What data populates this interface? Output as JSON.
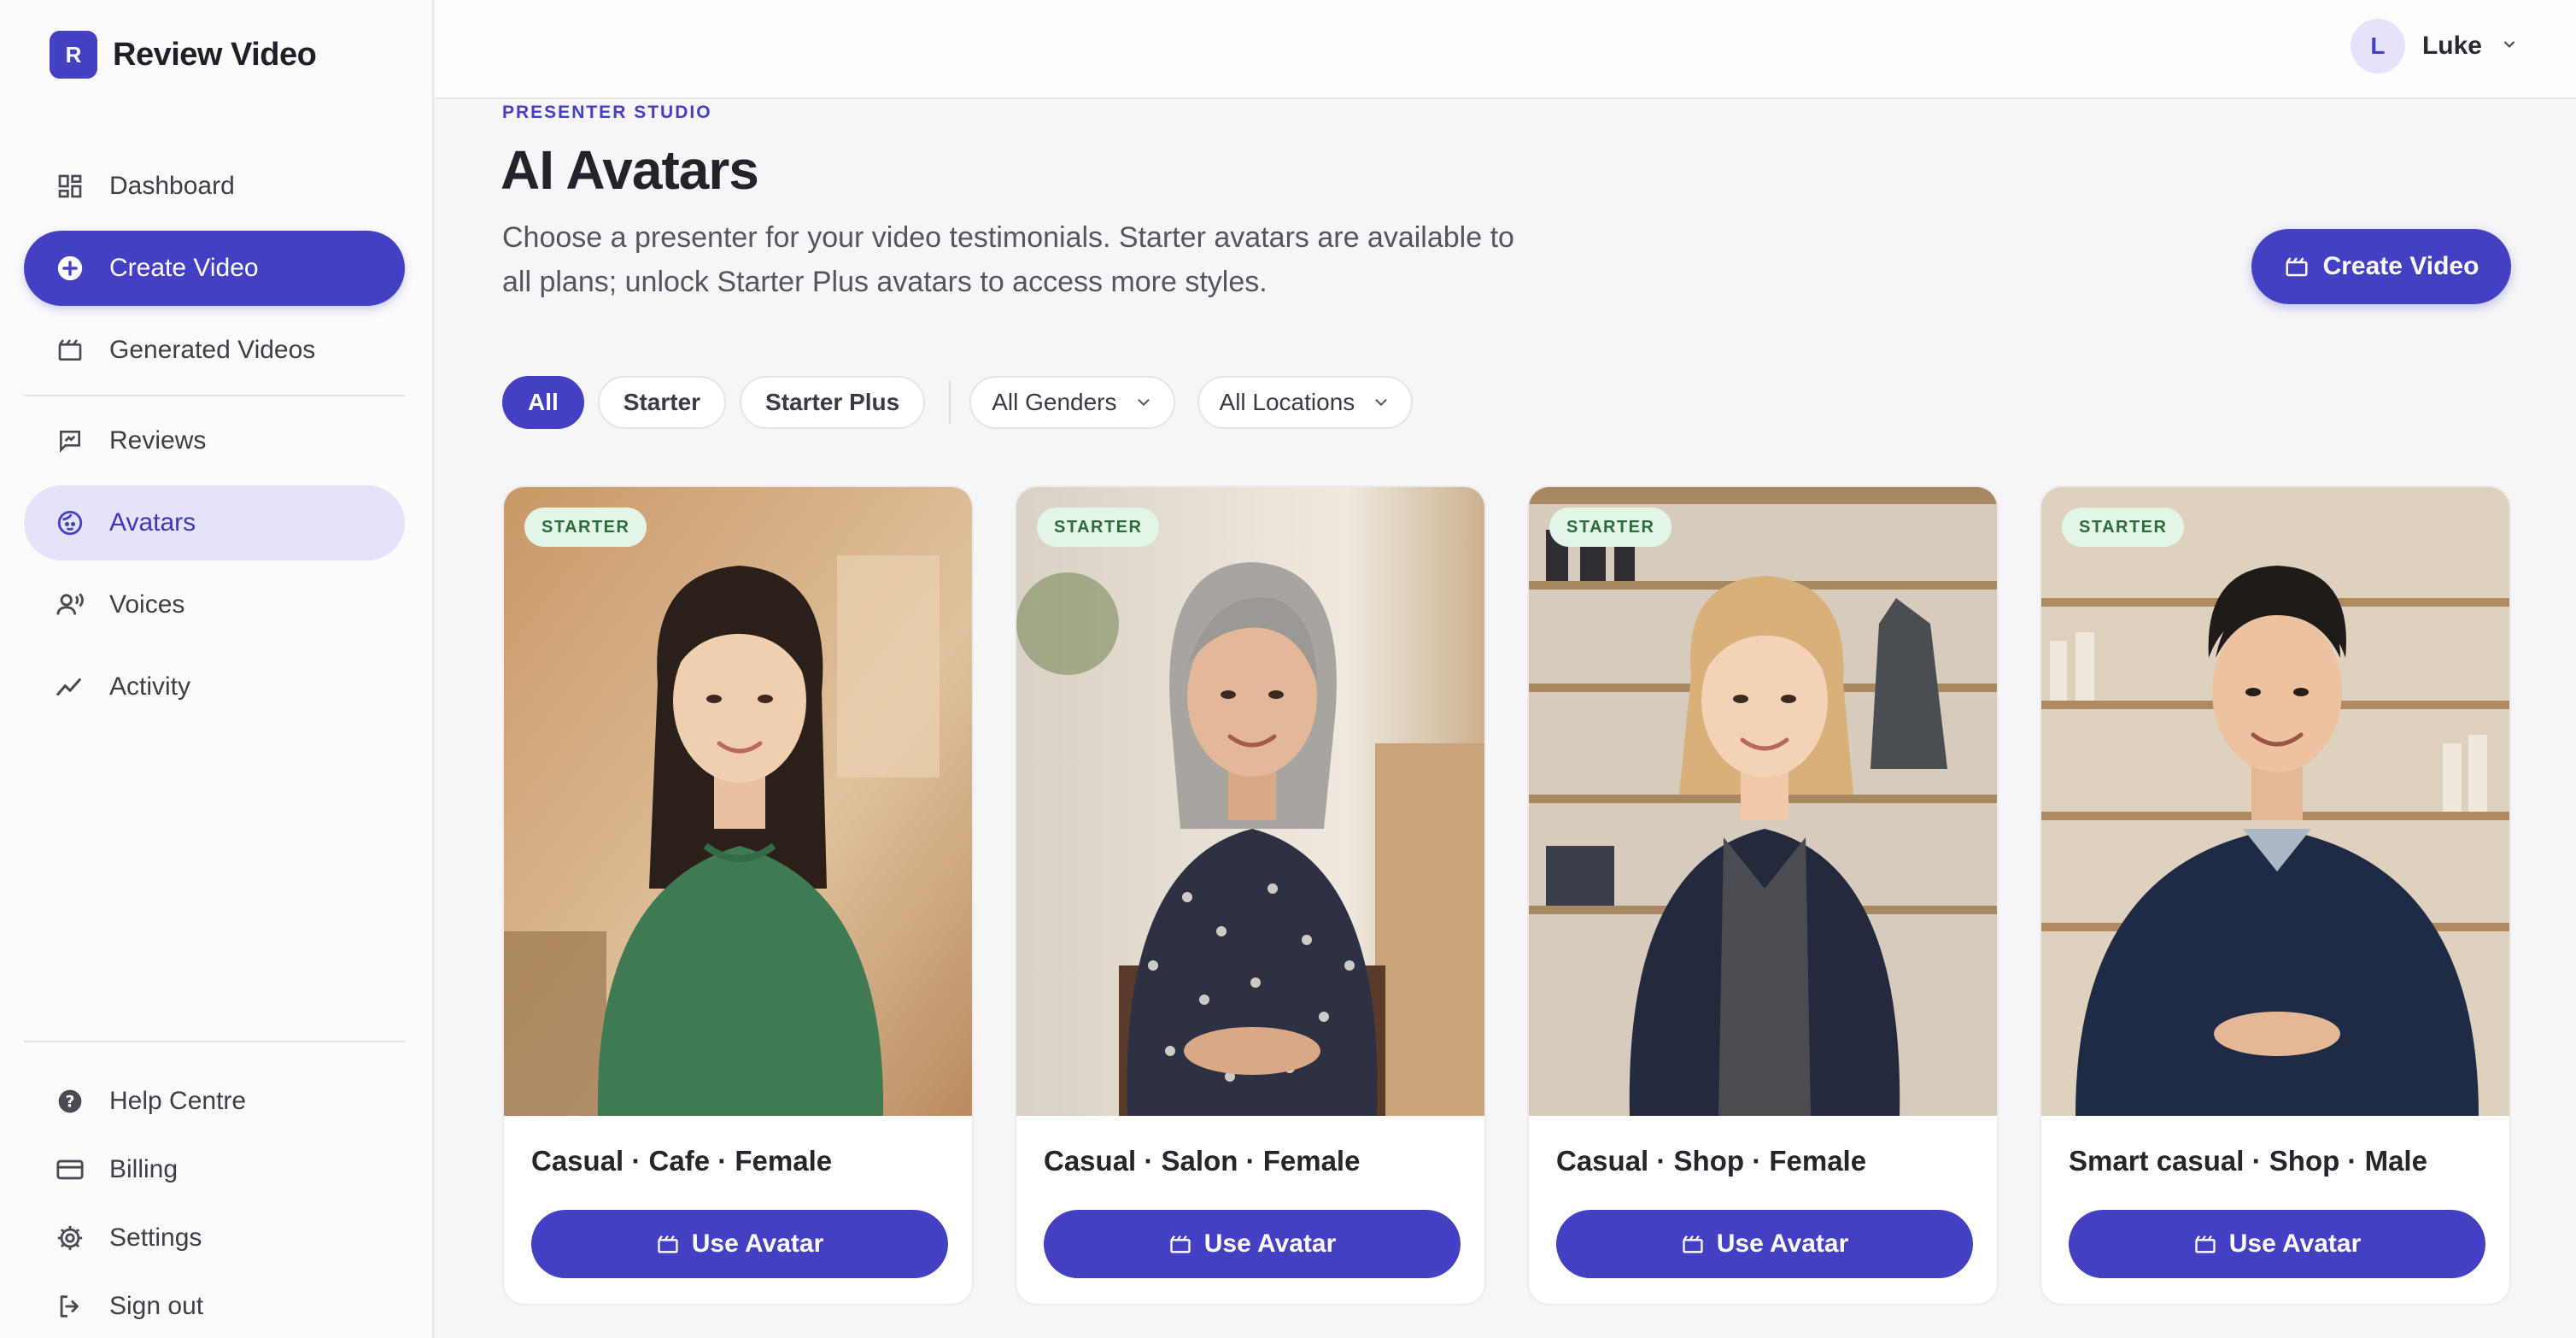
{
  "brand": {
    "logo_letter": "R",
    "name": "Review Video",
    "accent": "#4340c4"
  },
  "sidebar": {
    "items": [
      {
        "label": "Dashboard",
        "icon": "dashboard-icon"
      },
      {
        "label": "Create Video",
        "icon": "plus-circle-icon"
      },
      {
        "label": "Generated Videos",
        "icon": "clapperboard-icon"
      },
      {
        "label": "Reviews",
        "icon": "review-icon"
      },
      {
        "label": "Avatars",
        "icon": "avatar-icon"
      },
      {
        "label": "Voices",
        "icon": "voice-icon"
      },
      {
        "label": "Activity",
        "icon": "activity-icon"
      }
    ],
    "bottom_items": [
      {
        "label": "Help Centre",
        "icon": "help-icon"
      },
      {
        "label": "Billing",
        "icon": "credit-card-icon"
      },
      {
        "label": "Settings",
        "icon": "gear-icon"
      },
      {
        "label": "Sign out",
        "icon": "sign-out-icon"
      }
    ]
  },
  "user": {
    "initial": "L",
    "name": "Luke"
  },
  "header": {
    "eyebrow": "PRESENTER STUDIO",
    "title": "AI Avatars",
    "description": "Choose a presenter for your video testimonials. Starter avatars are available to all plans; unlock Starter Plus avatars to access more styles.",
    "cta_label": "Create Video"
  },
  "filters": {
    "tiers": [
      "All",
      "Starter",
      "Starter Plus"
    ],
    "selected_tier": "All",
    "gender": "All Genders",
    "location": "All Locations"
  },
  "avatars": [
    {
      "tier": "STARTER",
      "title": "Casual · Cafe · Female",
      "button": "Use Avatar"
    },
    {
      "tier": "STARTER",
      "title": "Casual · Salon · Female",
      "button": "Use Avatar"
    },
    {
      "tier": "STARTER",
      "title": "Casual · Shop · Female",
      "button": "Use Avatar"
    },
    {
      "tier": "STARTER",
      "title": "Smart casual · Shop · Male",
      "button": "Use Avatar"
    }
  ]
}
